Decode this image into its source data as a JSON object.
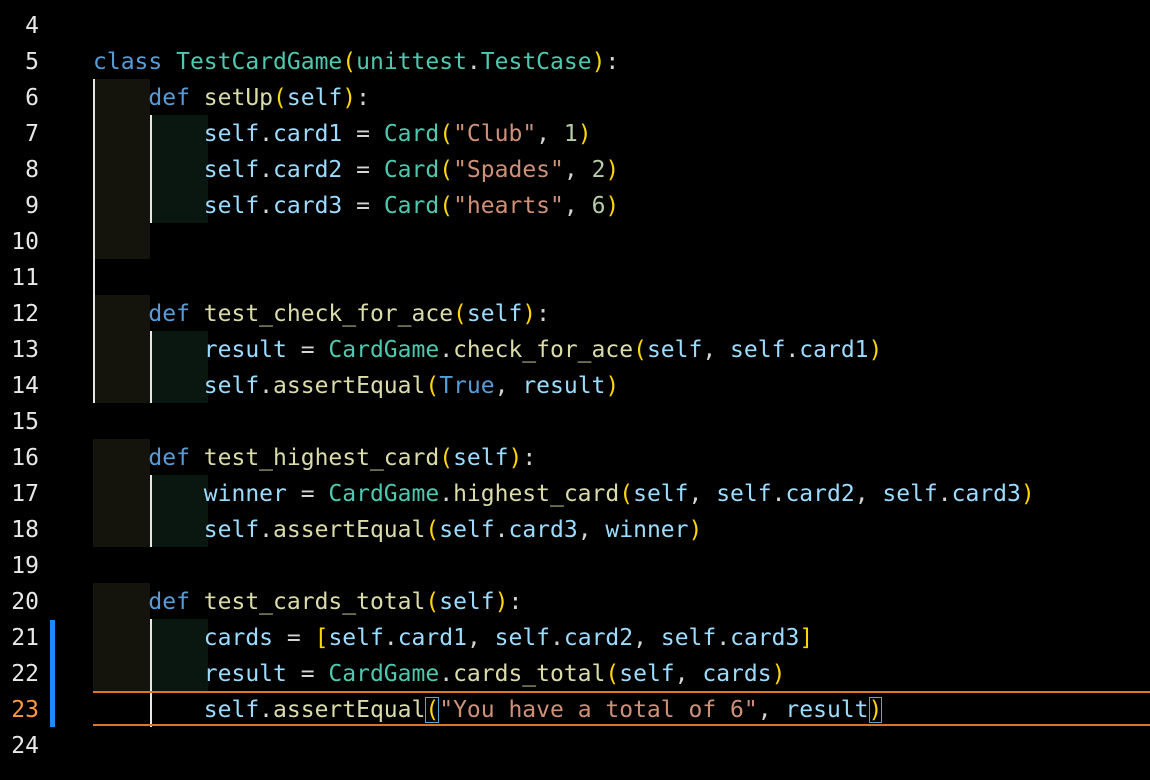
{
  "editor": {
    "current_line": 23,
    "lines": [
      {
        "num": "4",
        "tokens": []
      },
      {
        "num": "5",
        "tokens": [
          {
            "t": "class",
            "c": "k"
          },
          {
            "t": " ",
            "c": "p"
          },
          {
            "t": "TestCardGame",
            "c": "c"
          },
          {
            "t": "(",
            "c": "b1"
          },
          {
            "t": "unittest",
            "c": "c"
          },
          {
            "t": ".",
            "c": "p"
          },
          {
            "t": "TestCase",
            "c": "c"
          },
          {
            "t": ")",
            "c": "b1"
          },
          {
            "t": ":",
            "c": "p"
          }
        ]
      },
      {
        "num": "6",
        "tokens": [
          {
            "t": "    ",
            "c": "p"
          },
          {
            "t": "def",
            "c": "k"
          },
          {
            "t": " ",
            "c": "p"
          },
          {
            "t": "setUp",
            "c": "f"
          },
          {
            "t": "(",
            "c": "b1"
          },
          {
            "t": "self",
            "c": "v"
          },
          {
            "t": ")",
            "c": "b1"
          },
          {
            "t": ":",
            "c": "p"
          }
        ]
      },
      {
        "num": "7",
        "tokens": [
          {
            "t": "        ",
            "c": "p"
          },
          {
            "t": "self",
            "c": "v"
          },
          {
            "t": ".",
            "c": "p"
          },
          {
            "t": "card1",
            "c": "v"
          },
          {
            "t": " = ",
            "c": "p"
          },
          {
            "t": "Card",
            "c": "c"
          },
          {
            "t": "(",
            "c": "b1"
          },
          {
            "t": "\"Club\"",
            "c": "s"
          },
          {
            "t": ", ",
            "c": "p"
          },
          {
            "t": "1",
            "c": "n"
          },
          {
            "t": ")",
            "c": "b1"
          }
        ]
      },
      {
        "num": "8",
        "tokens": [
          {
            "t": "        ",
            "c": "p"
          },
          {
            "t": "self",
            "c": "v"
          },
          {
            "t": ".",
            "c": "p"
          },
          {
            "t": "card2",
            "c": "v"
          },
          {
            "t": " = ",
            "c": "p"
          },
          {
            "t": "Card",
            "c": "c"
          },
          {
            "t": "(",
            "c": "b1"
          },
          {
            "t": "\"Spades\"",
            "c": "s"
          },
          {
            "t": ", ",
            "c": "p"
          },
          {
            "t": "2",
            "c": "n"
          },
          {
            "t": ")",
            "c": "b1"
          }
        ]
      },
      {
        "num": "9",
        "tokens": [
          {
            "t": "        ",
            "c": "p"
          },
          {
            "t": "self",
            "c": "v"
          },
          {
            "t": ".",
            "c": "p"
          },
          {
            "t": "card3",
            "c": "v"
          },
          {
            "t": " = ",
            "c": "p"
          },
          {
            "t": "Card",
            "c": "c"
          },
          {
            "t": "(",
            "c": "b1"
          },
          {
            "t": "\"hearts\"",
            "c": "s"
          },
          {
            "t": ", ",
            "c": "p"
          },
          {
            "t": "6",
            "c": "n"
          },
          {
            "t": ")",
            "c": "b1"
          }
        ]
      },
      {
        "num": "10",
        "tokens": []
      },
      {
        "num": "11",
        "tokens": []
      },
      {
        "num": "12",
        "tokens": [
          {
            "t": "    ",
            "c": "p"
          },
          {
            "t": "def",
            "c": "k"
          },
          {
            "t": " ",
            "c": "p"
          },
          {
            "t": "test_check_for_ace",
            "c": "f"
          },
          {
            "t": "(",
            "c": "b1"
          },
          {
            "t": "self",
            "c": "v"
          },
          {
            "t": ")",
            "c": "b1"
          },
          {
            "t": ":",
            "c": "p"
          }
        ]
      },
      {
        "num": "13",
        "tokens": [
          {
            "t": "        ",
            "c": "p"
          },
          {
            "t": "result",
            "c": "v"
          },
          {
            "t": " = ",
            "c": "p"
          },
          {
            "t": "CardGame",
            "c": "c"
          },
          {
            "t": ".",
            "c": "p"
          },
          {
            "t": "check_for_ace",
            "c": "f"
          },
          {
            "t": "(",
            "c": "b1"
          },
          {
            "t": "self",
            "c": "v"
          },
          {
            "t": ", ",
            "c": "p"
          },
          {
            "t": "self",
            "c": "v"
          },
          {
            "t": ".",
            "c": "p"
          },
          {
            "t": "card1",
            "c": "v"
          },
          {
            "t": ")",
            "c": "b1"
          }
        ]
      },
      {
        "num": "14",
        "tokens": [
          {
            "t": "        ",
            "c": "p"
          },
          {
            "t": "self",
            "c": "v"
          },
          {
            "t": ".",
            "c": "p"
          },
          {
            "t": "assertEqual",
            "c": "f"
          },
          {
            "t": "(",
            "c": "b1"
          },
          {
            "t": "True",
            "c": "k"
          },
          {
            "t": ", ",
            "c": "p"
          },
          {
            "t": "result",
            "c": "v"
          },
          {
            "t": ")",
            "c": "b1"
          }
        ]
      },
      {
        "num": "15",
        "tokens": []
      },
      {
        "num": "16",
        "tokens": [
          {
            "t": "    ",
            "c": "p"
          },
          {
            "t": "def",
            "c": "k"
          },
          {
            "t": " ",
            "c": "p"
          },
          {
            "t": "test_highest_card",
            "c": "f"
          },
          {
            "t": "(",
            "c": "b1"
          },
          {
            "t": "self",
            "c": "v"
          },
          {
            "t": ")",
            "c": "b1"
          },
          {
            "t": ":",
            "c": "p"
          }
        ]
      },
      {
        "num": "17",
        "tokens": [
          {
            "t": "        ",
            "c": "p"
          },
          {
            "t": "winner",
            "c": "v"
          },
          {
            "t": " = ",
            "c": "p"
          },
          {
            "t": "CardGame",
            "c": "c"
          },
          {
            "t": ".",
            "c": "p"
          },
          {
            "t": "highest_card",
            "c": "f"
          },
          {
            "t": "(",
            "c": "b1"
          },
          {
            "t": "self",
            "c": "v"
          },
          {
            "t": ", ",
            "c": "p"
          },
          {
            "t": "self",
            "c": "v"
          },
          {
            "t": ".",
            "c": "p"
          },
          {
            "t": "card2",
            "c": "v"
          },
          {
            "t": ", ",
            "c": "p"
          },
          {
            "t": "self",
            "c": "v"
          },
          {
            "t": ".",
            "c": "p"
          },
          {
            "t": "card3",
            "c": "v"
          },
          {
            "t": ")",
            "c": "b1"
          }
        ]
      },
      {
        "num": "18",
        "tokens": [
          {
            "t": "        ",
            "c": "p"
          },
          {
            "t": "self",
            "c": "v"
          },
          {
            "t": ".",
            "c": "p"
          },
          {
            "t": "assertEqual",
            "c": "f"
          },
          {
            "t": "(",
            "c": "b1"
          },
          {
            "t": "self",
            "c": "v"
          },
          {
            "t": ".",
            "c": "p"
          },
          {
            "t": "card3",
            "c": "v"
          },
          {
            "t": ", ",
            "c": "p"
          },
          {
            "t": "winner",
            "c": "v"
          },
          {
            "t": ")",
            "c": "b1"
          }
        ]
      },
      {
        "num": "19",
        "tokens": []
      },
      {
        "num": "20",
        "tokens": [
          {
            "t": "    ",
            "c": "p"
          },
          {
            "t": "def",
            "c": "k"
          },
          {
            "t": " ",
            "c": "p"
          },
          {
            "t": "test_cards_total",
            "c": "f"
          },
          {
            "t": "(",
            "c": "b1"
          },
          {
            "t": "self",
            "c": "v"
          },
          {
            "t": ")",
            "c": "b1"
          },
          {
            "t": ":",
            "c": "p"
          }
        ]
      },
      {
        "num": "21",
        "tokens": [
          {
            "t": "        ",
            "c": "p"
          },
          {
            "t": "cards",
            "c": "v"
          },
          {
            "t": " = ",
            "c": "p"
          },
          {
            "t": "[",
            "c": "b1"
          },
          {
            "t": "self",
            "c": "v"
          },
          {
            "t": ".",
            "c": "p"
          },
          {
            "t": "card1",
            "c": "v"
          },
          {
            "t": ", ",
            "c": "p"
          },
          {
            "t": "self",
            "c": "v"
          },
          {
            "t": ".",
            "c": "p"
          },
          {
            "t": "card2",
            "c": "v"
          },
          {
            "t": ", ",
            "c": "p"
          },
          {
            "t": "self",
            "c": "v"
          },
          {
            "t": ".",
            "c": "p"
          },
          {
            "t": "card3",
            "c": "v"
          },
          {
            "t": "]",
            "c": "b1"
          }
        ]
      },
      {
        "num": "22",
        "tokens": [
          {
            "t": "        ",
            "c": "p"
          },
          {
            "t": "result",
            "c": "v"
          },
          {
            "t": " = ",
            "c": "p"
          },
          {
            "t": "CardGame",
            "c": "c"
          },
          {
            "t": ".",
            "c": "p"
          },
          {
            "t": "cards_total",
            "c": "f"
          },
          {
            "t": "(",
            "c": "b1"
          },
          {
            "t": "self",
            "c": "v"
          },
          {
            "t": ", ",
            "c": "p"
          },
          {
            "t": "cards",
            "c": "v"
          },
          {
            "t": ")",
            "c": "b1"
          }
        ]
      },
      {
        "num": "23",
        "tokens": [
          {
            "t": "        ",
            "c": "p"
          },
          {
            "t": "self",
            "c": "v"
          },
          {
            "t": ".",
            "c": "p"
          },
          {
            "t": "assertEqual",
            "c": "f"
          },
          {
            "t": "(",
            "c": "b1 mbr"
          },
          {
            "t": "\"You have a total of 6\"",
            "c": "s"
          },
          {
            "t": ", ",
            "c": "p"
          },
          {
            "t": "result",
            "c": "v"
          },
          {
            "t": ")",
            "c": "b1 mbr"
          }
        ]
      },
      {
        "num": "24",
        "tokens": []
      }
    ]
  }
}
